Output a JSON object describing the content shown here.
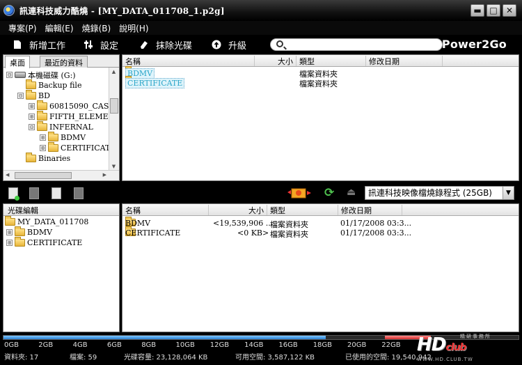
{
  "window": {
    "title": "訊連科技威力酷燒 - [MY_DATA_011708_1.p2g]",
    "minimize_glyph": "▬",
    "maximize_glyph": "□",
    "close_glyph": "✕"
  },
  "menu": [
    {
      "label": "專案(P)"
    },
    {
      "label": "編輯(E)"
    },
    {
      "label": "燒錄(B)"
    },
    {
      "label": "說明(H)"
    }
  ],
  "toolbar": {
    "new_task": "新增工作",
    "settings": "設定",
    "erase_disc": "抹除光碟",
    "upgrade": "升級",
    "search_placeholder": "",
    "brand": "Power2Go"
  },
  "source_tree": {
    "tabs": [
      "桌面",
      "最近的資料"
    ],
    "items": [
      {
        "label": "本機磁碟 (G:)",
        "expander": "⊟",
        "icon": "drive-icon"
      },
      {
        "label": "Backup file",
        "expander": "",
        "icon": "folder-icon"
      },
      {
        "label": "BD",
        "expander": "⊟",
        "icon": "folder-icon"
      },
      {
        "label": "60815090_CASI",
        "expander": "⊞",
        "icon": "folder-icon"
      },
      {
        "label": "FIFTH_ELEME",
        "expander": "⊞",
        "icon": "folder-icon"
      },
      {
        "label": "INFERNAL",
        "expander": "⊟",
        "icon": "folder-icon"
      },
      {
        "label": "BDMV",
        "expander": "⊞",
        "icon": "folder-icon"
      },
      {
        "label": "CERTIFICAT",
        "expander": "⊞",
        "icon": "folder-icon"
      },
      {
        "label": "Binaries",
        "expander": "",
        "icon": "folder-icon"
      }
    ]
  },
  "source_files": {
    "columns": [
      "名稱",
      "大小",
      "類型",
      "修改日期"
    ],
    "rows": [
      {
        "name": "BDMV",
        "size": "",
        "type": "檔案資料夾",
        "date": ""
      },
      {
        "name": "CERTIFICATE",
        "size": "",
        "type": "檔案資料夾",
        "date": ""
      }
    ]
  },
  "mid_toolbar": {
    "burner": "訊連科技映像檔燒錄程式 (25GB)"
  },
  "disc_tree": {
    "header": "光碟編輯",
    "items": [
      {
        "label": "MY_DATA_011708",
        "expander": ""
      },
      {
        "label": "BDMV",
        "expander": "⊞"
      },
      {
        "label": "CERTIFICATE",
        "expander": "⊞"
      }
    ]
  },
  "disc_files": {
    "columns": [
      "名稱",
      "大小",
      "類型",
      "修改日期"
    ],
    "rows": [
      {
        "name": "BDMV",
        "size": "<19,539,906 ...",
        "type": "檔案資料夾",
        "date": "01/17/2008 03:3..."
      },
      {
        "name": "CERTIFICATE",
        "size": "<0 KB>",
        "type": "檔案資料夾",
        "date": "01/17/2008 03:3..."
      }
    ]
  },
  "capacity": {
    "ticks": [
      "0GB",
      "2GB",
      "4GB",
      "6GB",
      "8GB",
      "10GB",
      "12GB",
      "14GB",
      "16GB",
      "18GB",
      "20GB",
      "22GB"
    ],
    "used_fraction": 0.625,
    "status": {
      "folders": "資料夾: 17",
      "files": "檔案: 59",
      "disc_capacity": "光碟容量: 23,128,064 KB",
      "free_space": "可用空間: 3,587,122 KB",
      "used_space": "已使用的空間: 19,540,942"
    },
    "fill_color": "#2b7fd0",
    "warn_color": "#d12b2b"
  },
  "watermark": {
    "logo": "HD",
    "logo_tail": "club",
    "sub": "精研事務所",
    "url": "WWW.HD.CLUB.TW"
  }
}
